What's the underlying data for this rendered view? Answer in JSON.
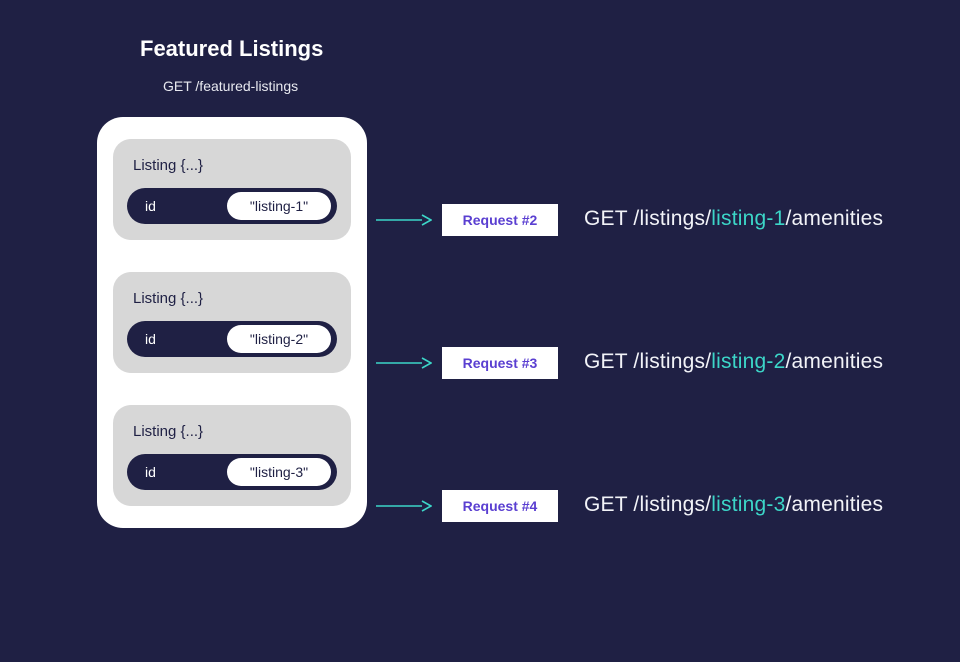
{
  "title": "Featured Listings",
  "subtitle": "GET /featured-listings",
  "listings": [
    {
      "head": "Listing {...}",
      "idKey": "id",
      "idVal": "\"listing-1\""
    },
    {
      "head": "Listing {...}",
      "idKey": "id",
      "idVal": "\"listing-2\""
    },
    {
      "head": "Listing {...}",
      "idKey": "id",
      "idVal": "\"listing-3\""
    }
  ],
  "requests": [
    {
      "badge": "Request #2",
      "prefix": "GET /listings/",
      "id": "listing-1",
      "suffix": "/amenities"
    },
    {
      "badge": "Request #3",
      "prefix": "GET /listings/",
      "id": "listing-2",
      "suffix": "/amenities"
    },
    {
      "badge": "Request #4",
      "prefix": "GET /listings/",
      "id": "listing-3",
      "suffix": "/amenities"
    }
  ],
  "colors": {
    "bg": "#1f2044",
    "accent": "#3cd6c8",
    "badgeText": "#5a3fd1"
  }
}
